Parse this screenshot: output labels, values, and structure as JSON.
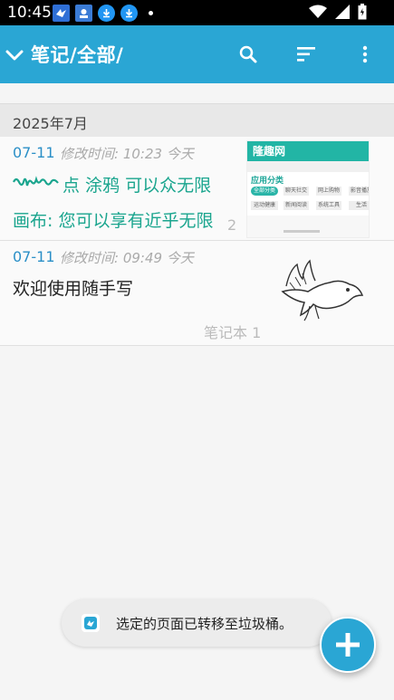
{
  "status_bar": {
    "time": "10:45"
  },
  "app_bar": {
    "title": "笔记/全部/"
  },
  "section": {
    "label": "2025年7月"
  },
  "notes": [
    {
      "date": "07-11",
      "modified": "修改时间: 10:23 今天",
      "line1": "点 涂鸦 可以众无限",
      "line2": "画布: 您可以享有近乎无限",
      "count": "2",
      "thumbnail": {
        "logo": "隆趣网",
        "heading": "应用分类",
        "chips": [
          "全部分类",
          "聊天社交",
          "网上购物",
          "影音播放",
          "运动健康",
          "新闻阅读",
          "系统工具",
          "生活"
        ]
      }
    },
    {
      "date": "07-11",
      "modified": "修改时间: 09:49 今天",
      "text": "欢迎使用随手写",
      "notebook": "笔记本 1"
    }
  ],
  "toast": {
    "text": "选定的页面已转移至垃圾桶。"
  },
  "colors": {
    "primary": "#2aa6d4",
    "accent_text": "#1aa58e",
    "date_blue": "#2a8fc7"
  }
}
